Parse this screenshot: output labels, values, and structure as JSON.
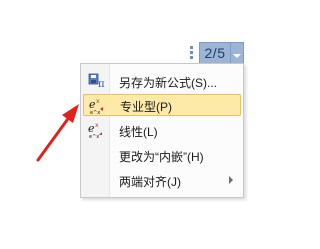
{
  "badge": {
    "page_text": "2/5"
  },
  "menu": {
    "items": [
      {
        "label": "另存为新公式(S)...",
        "icon": "save-as-formula-icon"
      },
      {
        "label": "专业型(P)",
        "icon": "professional-format-icon",
        "highlighted": true
      },
      {
        "label": "线性(L)",
        "icon": "linear-format-icon"
      },
      {
        "label": "更改为“内嵌”(H)",
        "icon": ""
      },
      {
        "label": "两端对齐(J)",
        "icon": "",
        "submenu": true
      }
    ]
  },
  "colors": {
    "highlight_bg": "#fde9a8",
    "highlight_border": "#e8c25f",
    "badge_bg": "#9cb5d6",
    "annotation_arrow": "#e0211d"
  }
}
